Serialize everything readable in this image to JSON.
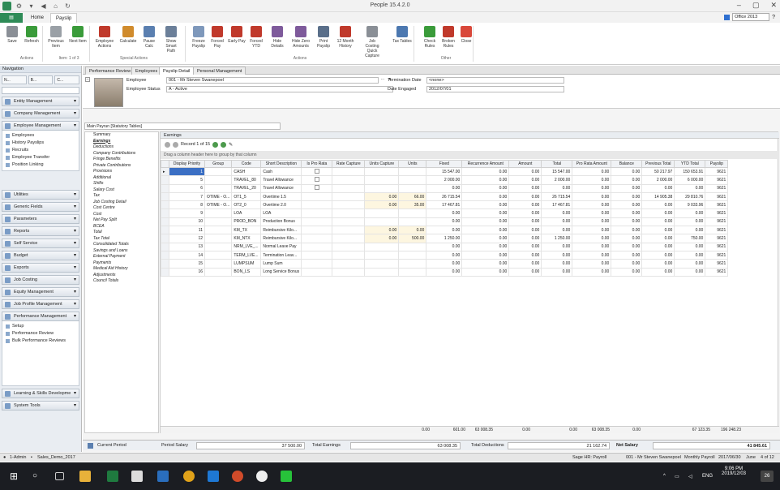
{
  "app": {
    "title": "People 15.4.2.0",
    "theme_label": "Office 2013"
  },
  "ribbon_tabs": {
    "file": "",
    "home": "Home",
    "payslip": "Payslip"
  },
  "ribbon": {
    "buttons": [
      {
        "label": "Save",
        "icon": "save-icon",
        "color": "#8a8f96"
      },
      {
        "label": "Refresh",
        "icon": "refresh-icon",
        "color": "#3a9b3a"
      },
      {
        "label": "Previous Item",
        "icon": "previous-icon",
        "color": "#9aa0a6"
      },
      {
        "label": "Next Item",
        "icon": "next-icon",
        "color": "#3a9b3a"
      },
      {
        "label": "Employee Actions",
        "icon": "employee-actions-icon",
        "color": "#c0392b"
      },
      {
        "label": "Calculate",
        "icon": "calculate-icon",
        "color": "#d08b2c"
      },
      {
        "label": "Pause Calc",
        "icon": "pause-icon",
        "color": "#5a7fb0"
      },
      {
        "label": "Show Smart Path",
        "icon": "smart-path-icon",
        "color": "#6b7f99"
      },
      {
        "label": "Freeze Payslip",
        "icon": "freeze-icon",
        "color": "#7e98bb"
      },
      {
        "label": "Forced Pay",
        "icon": "forced-pay-icon",
        "color": "#c0392b"
      },
      {
        "label": "Early Pay",
        "icon": "early-pay-icon",
        "color": "#c0392b"
      },
      {
        "label": "Forced YTD",
        "icon": "forced-ytd-icon",
        "color": "#c0392b"
      },
      {
        "label": "Hide Details",
        "icon": "hide-details-icon",
        "color": "#7e5a9b"
      },
      {
        "label": "Hide Zero Amounts",
        "icon": "hide-zero-icon",
        "color": "#7e5a9b"
      },
      {
        "label": "Print Payslip",
        "icon": "print-icon",
        "color": "#5a6f8a"
      },
      {
        "label": "12 Month History",
        "icon": "history-icon",
        "color": "#c0392b"
      },
      {
        "label": "Job Costing Quick Capture",
        "icon": "job-costing-icon",
        "color": "#8a8f96"
      },
      {
        "label": "Tax Tables",
        "icon": "tax-tables-icon",
        "color": "#4c78b0"
      },
      {
        "label": "Check Rules",
        "icon": "check-rules-icon",
        "color": "#3a9b3a"
      },
      {
        "label": "Broken Rules",
        "icon": "broken-rules-icon",
        "color": "#c0392b"
      },
      {
        "label": "Close",
        "icon": "close-icon",
        "color": "#d9483a"
      }
    ],
    "groups": {
      "actions": "Actions",
      "item": "Item: 1 of 3",
      "special": "Special Actions",
      "actions2": "Actions",
      "other": "Other"
    }
  },
  "nav": {
    "header": "Navigation",
    "top": [
      "N...",
      "B...",
      "C..."
    ],
    "groups": [
      "Entity Management",
      "Company Management",
      "Employee Management"
    ],
    "employee_items": [
      "Employees",
      "History Payslips",
      "Recruits",
      "Employee Transfer",
      "Position Linking"
    ],
    "groups2": [
      "Utilities",
      "Generic Fields",
      "Parameters",
      "Reports",
      "Self Service",
      "Budget",
      "Exports",
      "Job Costing",
      "Equity Management",
      "Job Profile Management",
      "Performance Management"
    ],
    "perf_items": [
      "Setup",
      "Performance Review",
      "Bulk Performance Reviews"
    ],
    "groups3": [
      "Learning & Skills Developme",
      "System Tools"
    ]
  },
  "doc_tabs": [
    "Performance Review",
    "Employees",
    "Payslip Detail",
    "Personal Management"
  ],
  "employee": {
    "employee_label": "Employee",
    "employee_value": "001 - Mr Steven Swanepoel",
    "status_label": "Employee Status",
    "status_value": "A - Active",
    "term_label": "Termination Date",
    "term_value": "<none>",
    "engaged_label": "Date Engaged",
    "engaged_value": "2012/07/01",
    "payrun": "Main Payrun [Statutory Tables]"
  },
  "summary_items": [
    "Summary",
    "Earnings",
    "Deductions",
    "Company Contributions",
    "Fringe Benefits",
    "Private Contributions",
    "Provisions",
    "Additional",
    "Shifts",
    "Salary Cost",
    "Tax",
    "Job Costing Detail",
    "Cost Centre",
    "Cost",
    "Net Pay Split",
    "BCEA",
    "Total",
    "Tax Total",
    "Consolidated Totals",
    "Savings and Loans",
    "External Payment",
    "Payments",
    "Medical Aid History",
    "Adjustments",
    "Council Totals"
  ],
  "grid": {
    "header": "Earnings",
    "record": "Record 1 of 15",
    "groupby": "Drag a column header here to group by that column",
    "columns": [
      "Display Priority",
      "Group",
      "Code",
      "Short Description",
      "Is Pro Rata",
      "Rate Capture",
      "Units Capture",
      "Units",
      "Fixed",
      "Recurrence Amount",
      "Amount",
      "Total",
      "Pro Rata Amount",
      "Balance",
      "Previous Total",
      "YTD Total",
      "Payslip"
    ],
    "rows": [
      [
        "1",
        "",
        "CASH",
        "Cash",
        "",
        "",
        "",
        "",
        "15 547.00",
        "0.00",
        "0.00",
        "15 547.00",
        "0.00",
        "0.00",
        "50 217.97",
        "150 653.91",
        "9621"
      ],
      [
        "5",
        "",
        "TRAVEL_80",
        "Travel Allowance",
        "",
        "",
        "",
        "",
        "2 000.00",
        "0.00",
        "0.00",
        "2 000.00",
        "0.00",
        "0.00",
        "2 000.00",
        "6 000.00",
        "9621"
      ],
      [
        "6",
        "",
        "TRAVEL_20",
        "Travel Allowance",
        "",
        "",
        "",
        "",
        "0.00",
        "0.00",
        "0.00",
        "0.00",
        "0.00",
        "0.00",
        "0.00",
        "0.00",
        "9621"
      ],
      [
        "7",
        "OTIME - O...",
        "OT1_5",
        "Overtime 1.5",
        "",
        "",
        "0.00",
        "66.00",
        "26 715.54",
        "0.00",
        "0.00",
        "26 715.54",
        "0.00",
        "0.00",
        "14 905.38",
        "29 810.76",
        "9621"
      ],
      [
        "8",
        "OTIME - O...",
        "OT2_0",
        "Overtime 2.0",
        "",
        "",
        "0.00",
        "35.00",
        "17 467.81",
        "0.00",
        "0.00",
        "17 467.81",
        "0.00",
        "0.00",
        "0.00",
        "9 033.96",
        "9621"
      ],
      [
        "9",
        "",
        "LOA",
        "LOA",
        "",
        "",
        "",
        "",
        "0.00",
        "0.00",
        "0.00",
        "0.00",
        "0.00",
        "0.00",
        "0.00",
        "0.00",
        "9621"
      ],
      [
        "10",
        "",
        "PROD_BON",
        "Production Bonus",
        "",
        "",
        "",
        "",
        "0.00",
        "0.00",
        "0.00",
        "0.00",
        "0.00",
        "0.00",
        "0.00",
        "0.00",
        "9621"
      ],
      [
        "11",
        "",
        "KM_TX",
        "Reimbursive Kilo...",
        "",
        "",
        "0.00",
        "0.00",
        "0.00",
        "0.00",
        "0.00",
        "0.00",
        "0.00",
        "0.00",
        "0.00",
        "0.00",
        "9621"
      ],
      [
        "12",
        "",
        "KM_NTX",
        "Reimbursive Kilo...",
        "",
        "",
        "0.00",
        "500.00",
        "1 250.00",
        "0.00",
        "0.00",
        "1 250.00",
        "0.00",
        "0.00",
        "0.00",
        "750.00",
        "9621"
      ],
      [
        "13",
        "",
        "NRM_LVE_...",
        "Normal Leave Pay",
        "",
        "",
        "",
        "",
        "0.00",
        "0.00",
        "0.00",
        "0.00",
        "0.00",
        "0.00",
        "0.00",
        "0.00",
        "9621"
      ],
      [
        "14",
        "",
        "TERM_LVE...",
        "Termination Leav...",
        "",
        "",
        "",
        "",
        "0.00",
        "0.00",
        "0.00",
        "0.00",
        "0.00",
        "0.00",
        "0.00",
        "0.00",
        "9621"
      ],
      [
        "15",
        "",
        "LUMPSUM",
        "Lump Sum",
        "",
        "",
        "",
        "",
        "0.00",
        "0.00",
        "0.00",
        "0.00",
        "0.00",
        "0.00",
        "0.00",
        "0.00",
        "9621"
      ],
      [
        "16",
        "",
        "BON_LS",
        "Long Service Bonus",
        "",
        "",
        "",
        "",
        "0.00",
        "0.00",
        "0.00",
        "0.00",
        "0.00",
        "0.00",
        "0.00",
        "0.00",
        "9621"
      ]
    ],
    "totals": {
      "units_capture": "0.00",
      "units": "601.00",
      "fixed": "63 008.35",
      "recurrence": "0.00",
      "amount": "0.00",
      "total": "63 008.35",
      "pro_rata": "0.00",
      "previous": "67 123.35",
      "ytd": "196 248.23"
    }
  },
  "footer": {
    "current_period": "Current Period",
    "period_salary_label": "Period Salary",
    "period_salary": "37 500.00",
    "total_earnings_label": "Total Earnings",
    "total_earnings": "63 008.35",
    "total_deductions_label": "Total Deductions",
    "total_deductions": "21 162.74",
    "net_salary_label": "Net Salary",
    "net_salary": "41 845.61"
  },
  "status": {
    "user": "1-Admin",
    "db": "Sales_Demo_2017",
    "company": "Sage HR: Payroll",
    "employee": "001 - Mr Steven Swanepoel",
    "payrun": "Monthly Payroll",
    "period": "2017/06/30",
    "month": "June",
    "pages": "4 of 12"
  },
  "taskbar": {
    "lang": "ENG",
    "time": "9:06 PM",
    "date": "2019/12/03",
    "notif": "26"
  }
}
